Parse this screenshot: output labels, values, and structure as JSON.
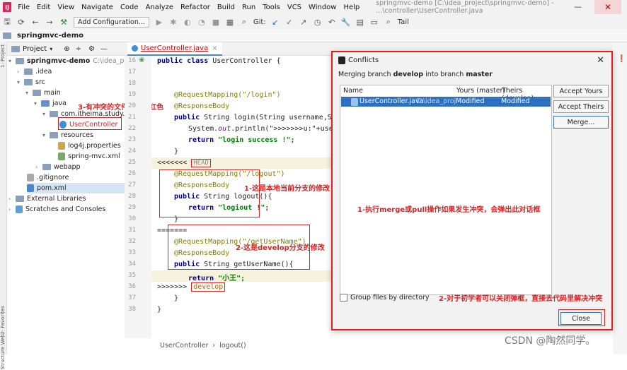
{
  "menubar": {
    "logo": "IJ",
    "items": [
      "File",
      "Edit",
      "View",
      "Navigate",
      "Code",
      "Analyze",
      "Refactor",
      "Build",
      "Run",
      "Tools",
      "VCS",
      "Window",
      "Help"
    ],
    "title": "springmvc-demo [C:\\idea_project\\springmvc-demo] - ...\\controller\\UserController.java",
    "minimize": "—",
    "close": "✕"
  },
  "toolbar": {
    "config_label": "Add Configuration...",
    "git_label": "Git:",
    "tail_label": "Tail"
  },
  "navbar": {
    "project": "springmvc-demo"
  },
  "left_strip": {
    "project": "1: Project",
    "favorites": "2: Favorites",
    "web": "Web",
    "structure": "Structure"
  },
  "project_panel": {
    "header": "Project",
    "tree": [
      {
        "label": "springmvc-demo",
        "path": "C:\\idea_project"
      },
      {
        "label": ".idea"
      },
      {
        "label": "src"
      },
      {
        "label": "main"
      },
      {
        "label": "java"
      },
      {
        "label": "com.itheima.study.n"
      },
      {
        "label": "UserController"
      },
      {
        "label": "resources"
      },
      {
        "label": "log4j.properties"
      },
      {
        "label": "spring-mvc.xml"
      },
      {
        "label": "webapp"
      },
      {
        "label": ".gitignore"
      },
      {
        "label": "pom.xml"
      },
      {
        "label": "External Libraries"
      },
      {
        "label": "Scratches and Consoles"
      }
    ]
  },
  "editor": {
    "tab_label": "UserController.java",
    "line_numbers": [
      "16",
      "17",
      "18",
      "19",
      "20",
      "21",
      "22",
      "23",
      "24",
      "25",
      "26",
      "27",
      "28",
      "29",
      "30",
      "31",
      "32",
      "33",
      "34",
      "35",
      "36",
      "37",
      "38"
    ],
    "lines": {
      "l16_kw": "public class",
      "l16_rest": " UserController {",
      "l19": "@RequestMapping(\"/login\")",
      "l20": "@ResponseBody",
      "l21_kw": "public",
      "l21_rest": " String login(String username,Stri",
      "l22_a": "System.",
      "l22_b": "out",
      "l22_c": ".println(\">>>>>>>u:\"+userm",
      "l23_kw": "return",
      "l23_str": " \"login success !\";",
      "l24": "}",
      "l25_marker": "<<<<<<<",
      "l25_head": "HEAD",
      "l26": "@RequestMapping(\"/logout\")",
      "l27": "@ResponseBody",
      "l28_kw": "public",
      "l28_rest": " String logout(){",
      "l29_kw": "return",
      "l29_str": " \"logiout !\";",
      "l30": "}",
      "l31": "=======",
      "l32": "@RequestMapping(\"/getUserName\")",
      "l33": "@ResponseBody",
      "l34_kw": "public",
      "l34_rest": " String getUserName(){",
      "l35_kw": "return",
      "l35_str": " \"小王\";",
      "l36_marker": ">>>>>>>",
      "l36_branch": "develop",
      "l37": "}",
      "l38": "}"
    },
    "breadcrumb_class": "UserController",
    "breadcrumb_sep": "›",
    "breadcrumb_method": "logout()"
  },
  "annotations": {
    "a1": "1-这是本地当前分支的修改",
    "a2": "2-这是develop分支的修改",
    "a3": "3-有冲突的文件会显示红色",
    "a4": "1-执行merge或pull操作如果发生冲突，会弹出此对话框",
    "a5": "2-对于初学者可以关闭弹框，直接去代码里解决冲突"
  },
  "dialog": {
    "title": "Conflicts",
    "close_icon": "✕",
    "subtitle_pre": "Merging branch ",
    "subtitle_branch1": "develop",
    "subtitle_mid": " into branch ",
    "subtitle_branch2": "master",
    "columns": [
      "Name",
      "Yours (master)",
      "Theirs (develop)"
    ],
    "row": {
      "name": "UserController.java",
      "path": "C:\\idea_proj",
      "yours": "Modified",
      "theirs": "Modified"
    },
    "btn_accept_yours": "Accept Yours",
    "btn_accept_theirs": "Accept Theirs",
    "btn_merge": "Merge...",
    "group_label": "Group files by directory",
    "btn_close": "Close"
  },
  "watermark": "CSDN @陶然同学。",
  "colors": {
    "accent": "#2f6fbf",
    "annotation_red": "#e02020",
    "conflict_bg": "#f7f2dc"
  }
}
